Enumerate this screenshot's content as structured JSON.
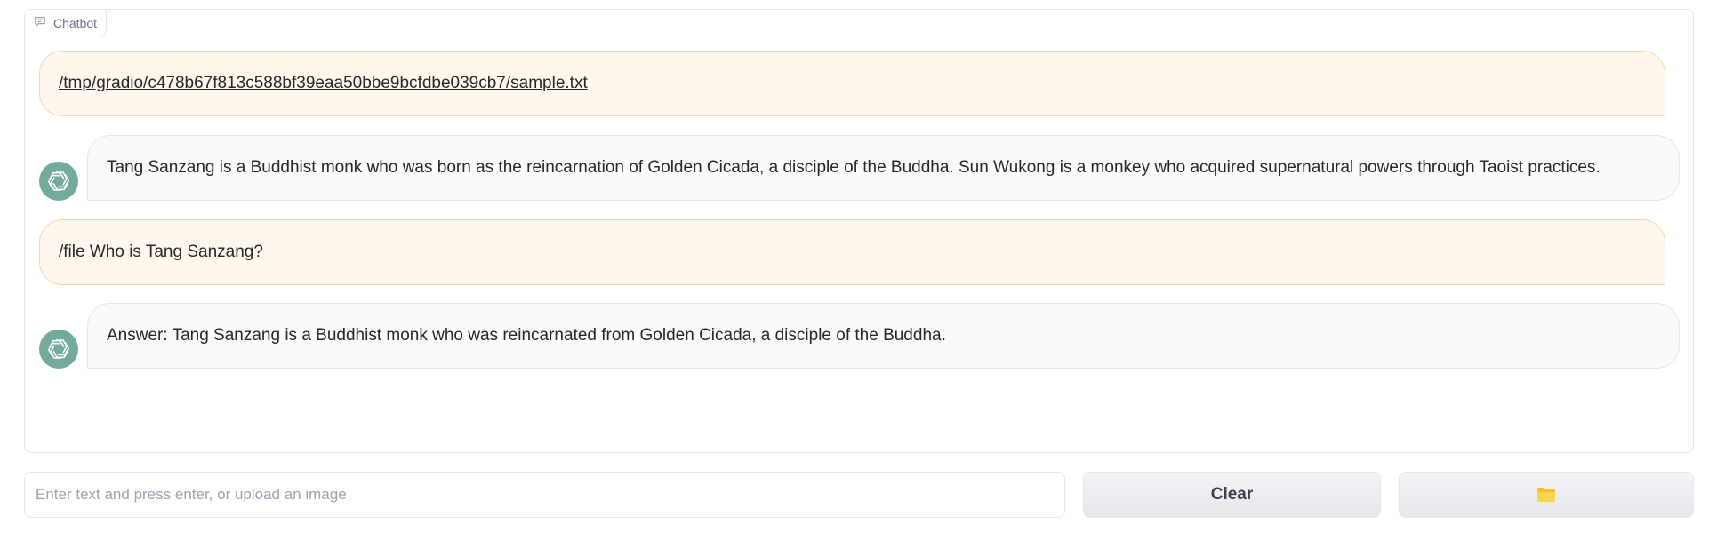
{
  "chatbot": {
    "label": "Chatbot",
    "messages": [
      {
        "role": "user",
        "text": "/tmp/gradio/c478b67f813c588bf39eaa50bbe9bcfdbe039cb7/sample.txt",
        "is_link": true
      },
      {
        "role": "bot",
        "text": "Tang Sanzang is a Buddhist monk who was born as the reincarnation of Golden Cicada, a disciple of the Buddha. Sun Wukong is a monkey who acquired supernatural powers through Taoist practices."
      },
      {
        "role": "user",
        "text": "/file Who is Tang Sanzang?"
      },
      {
        "role": "bot",
        "text": "Answer: Tang Sanzang is a Buddhist monk who was reincarnated from Golden Cicada, a disciple of the Buddha."
      }
    ]
  },
  "input": {
    "placeholder": "Enter text and press enter, or upload an image",
    "value": ""
  },
  "buttons": {
    "clear_label": "Clear",
    "upload_icon": "folder-icon"
  },
  "colors": {
    "user_bubble": "#fff7ed",
    "user_border": "#fed7aa",
    "bot_bubble": "#f9fafb",
    "avatar": "#74aa9c",
    "folder": "#fbbf24"
  }
}
